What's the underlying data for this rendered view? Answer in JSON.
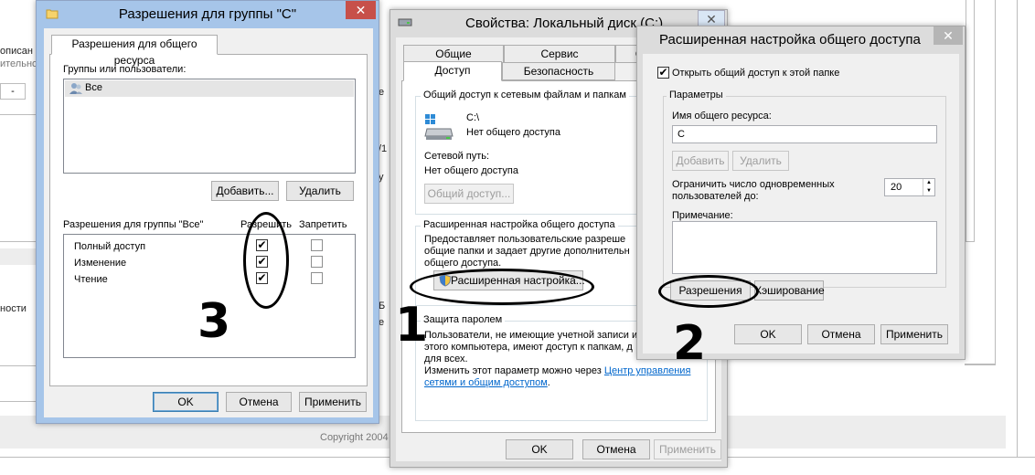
{
  "background": {
    "left_text_1": "описан",
    "left_text_2": "ительно)",
    "left_text_3": "-",
    "left_text_4": "ности",
    "mid_text_1": "е",
    "mid_text_2": "/1",
    "mid_text_3": "у",
    "mid_text_4": "е",
    "mid_text_5": "Б",
    "copyright": "Copyright 2004"
  },
  "group_perm_dialog": {
    "title": "Разрешения для группы \"С\"",
    "tab": "Разрешения для общего ресурса",
    "groups_label": "Группы или пользователи:",
    "users": [
      {
        "name": "Все"
      }
    ],
    "add_button": "Добавить...",
    "remove_button": "Удалить",
    "perm_header": "Разрешения для группы \"Все\"",
    "allow_header": "Разрешить",
    "deny_header": "Запретить",
    "permissions": [
      {
        "name": "Полный доступ",
        "allow": "✔",
        "deny": ""
      },
      {
        "name": "Изменение",
        "allow": "✔",
        "deny": ""
      },
      {
        "name": "Чтение",
        "allow": "✔",
        "deny": ""
      }
    ],
    "ok_button": "OK",
    "cancel_button": "Отмена",
    "apply_button": "Применить"
  },
  "disk_dialog": {
    "title": "Свойства: Локальный диск (C:)",
    "tabs_row1": [
      "Общие",
      "Сервис",
      "Об"
    ],
    "tabs_row2": [
      "Доступ",
      "Безопасность"
    ],
    "net_share_group": "Общий доступ к сетевым файлам и папкам",
    "drive_path": "C:\\",
    "drive_status": "Нет общего доступа",
    "net_path_label": "Сетевой путь:",
    "net_path_value": "Нет общего доступа",
    "share_button": "Общий доступ...",
    "advanced_group": "Расширенная настройка общего доступа",
    "advanced_desc_1": "Предоставляет пользовательские разреше",
    "advanced_desc_2": "общие папки и задает другие дополнительн",
    "advanced_desc_3": "общего доступа.",
    "advanced_button": "Расширенная настройка...",
    "password_group": "Защита паролем",
    "password_desc_1": "Пользователи, не имеющие учетной записи и",
    "password_desc_2": "этого компьютера, имеют доступ к папкам, д",
    "password_desc_3": "для всех.",
    "password_desc_4": "Изменить этот параметр можно через ",
    "password_link_1": "Центр управления",
    "password_link_2": "сетями и общим доступом",
    "password_link_end": ".",
    "ok_button": "OK",
    "cancel_button": "Отмена",
    "apply_button": "Применить"
  },
  "advanced_dialog": {
    "title": "Расширенная настройка общего доступа",
    "share_checkbox_label": "Открыть общий доступ к этой папке",
    "share_checked": "✔",
    "params_group": "Параметры",
    "share_name_label": "Имя общего ресурса:",
    "share_name_value": "C",
    "add_button": "Добавить",
    "remove_button": "Удалить",
    "limit_label_1": "Ограничить число одновременных",
    "limit_label_2": "пользователей до:",
    "limit_value": "20",
    "note_label": "Примечание:",
    "permissions_button": "Разрешения",
    "caching_button": "Кэширование",
    "ok_button": "OK",
    "cancel_button": "Отмена",
    "apply_button": "Применить"
  },
  "annotations": {
    "step1": "1",
    "step2": "2",
    "step3": "3"
  }
}
